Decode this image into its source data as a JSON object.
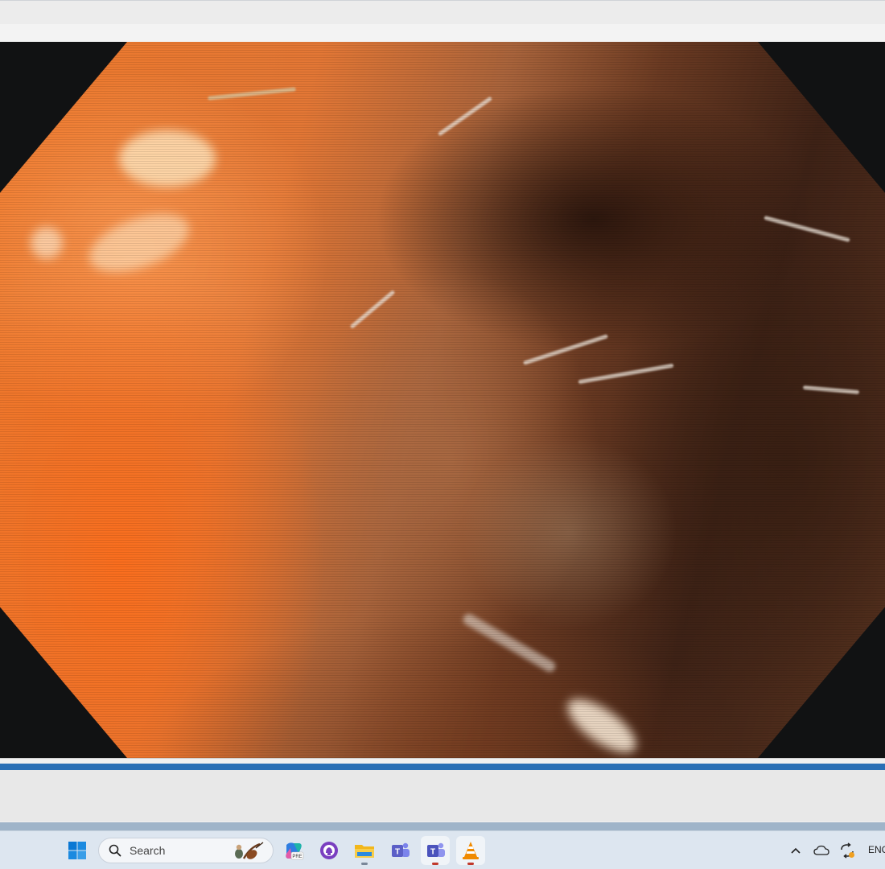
{
  "player": {
    "progress_fraction": 1.0,
    "progress_color": "#2a6fb5"
  },
  "taskbar": {
    "start_icon": "windows-start-icon",
    "search": {
      "placeholder": "Search",
      "icon": "search-icon"
    },
    "apps": [
      {
        "name": "copilot-app-icon",
        "label": "PRE"
      },
      {
        "name": "github-desktop-icon"
      },
      {
        "name": "file-explorer-icon"
      },
      {
        "name": "teams-classic-icon"
      },
      {
        "name": "teams-icon"
      },
      {
        "name": "vlc-icon"
      }
    ],
    "tray": {
      "chevron": "chevron-up-icon",
      "onedrive": "onedrive-cloud-icon",
      "sync": "sync-icon",
      "language": "ENG"
    }
  },
  "colors": {
    "taskbar_bg": "#dde6f0",
    "windows_blue": "#0a78d4",
    "teams_purple": "#5b5fc7",
    "vlc_orange": "#f08a00"
  }
}
